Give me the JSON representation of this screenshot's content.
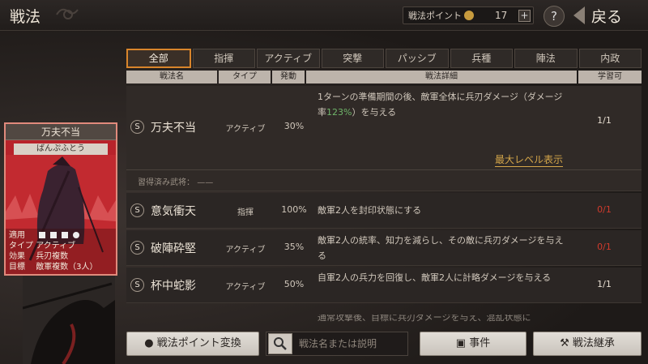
{
  "header": {
    "title": "戦法",
    "points_label": "戦法ポイント",
    "points_value": "17",
    "plus": "+",
    "help": "?",
    "back": "戻る"
  },
  "tabs": [
    {
      "label": "全部",
      "active": true
    },
    {
      "label": "指揮"
    },
    {
      "label": "アクティブ"
    },
    {
      "label": "突撃"
    },
    {
      "label": "パッシブ"
    },
    {
      "label": "兵種"
    },
    {
      "label": "陣法"
    },
    {
      "label": "内政"
    }
  ],
  "columns": {
    "name": "戦法名",
    "type": "タイプ",
    "activation": "発動",
    "detail": "戦法詳細",
    "learnable": "学習可"
  },
  "rows": [
    {
      "badge": "S",
      "name": "万夫不当",
      "type": "アクティブ",
      "activation": "30%",
      "detail_pre": "1ターンの準備期間の後、敵軍全体に兵刃ダメージ（ダメージ率",
      "detail_highlight": "123%",
      "detail_post": "）を与える",
      "learnable": "1/1",
      "max_level_link": "最大レベル表示",
      "learned_label": "習得済み武将：",
      "learned_value": "——"
    },
    {
      "badge": "S",
      "name": "意気衝天",
      "type": "指揮",
      "activation": "100%",
      "detail": "敵軍2人を封印状態にする",
      "learnable": "0/1"
    },
    {
      "badge": "S",
      "name": "破陣砕堅",
      "type": "アクティブ",
      "activation": "35%",
      "detail": "敵軍2人の統率、知力を減らし、その敵に兵刃ダメージを与える",
      "learnable": "0/1"
    },
    {
      "badge": "S",
      "name": "杯中蛇影",
      "type": "アクティブ",
      "activation": "50%",
      "detail": "自軍2人の兵力を回復し、敵軍2人に計略ダメージを与える",
      "learnable": "1/1"
    }
  ],
  "partial_row": {
    "detail": "通常攻撃後、目標に兵刃ダメージを与え、混乱状態に"
  },
  "card": {
    "title": "万夫不当",
    "reading": "ばんぷふとう",
    "apply_label": "適用",
    "type_label": "タイプ",
    "type_value": "アクティブ",
    "effect_label": "効果",
    "effect_value": "兵刃複数",
    "target_label": "目標",
    "target_value": "敵軍複数（3人）"
  },
  "bottom": {
    "convert": "戦法ポイント変換",
    "search_placeholder": "戦法名または説明",
    "events": "事件",
    "inherit": "戦法継承"
  },
  "colors": {
    "accent": "#d9852b",
    "highlight_green": "#6fb56a",
    "link_gold": "#d4a64a",
    "unavailable_red": "#d13a2c",
    "card_red": "#b8232b"
  }
}
